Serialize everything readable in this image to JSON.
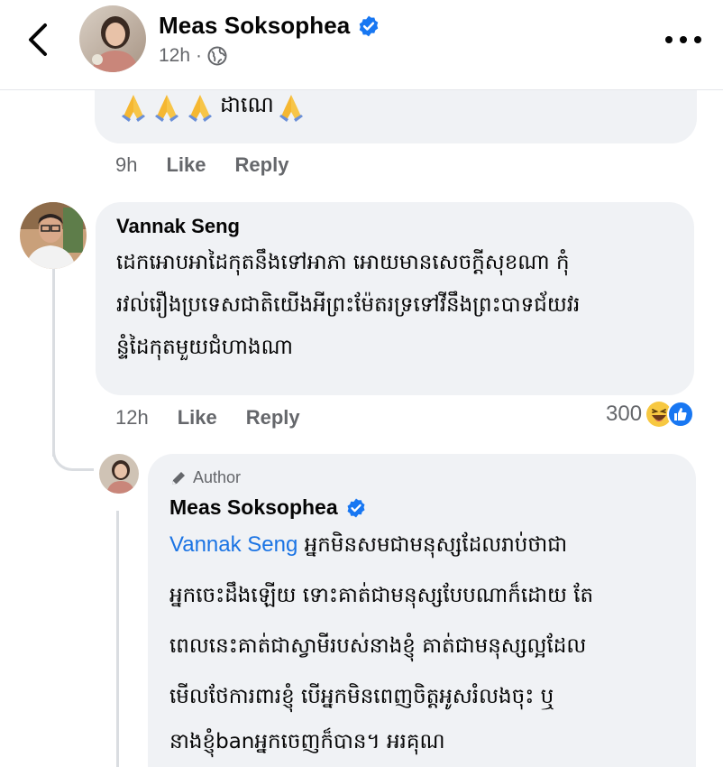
{
  "header": {
    "author_name": "Meas Soksophea",
    "time": "12h",
    "separator": "·",
    "icons": {
      "back": "chevron-left-icon",
      "verified": "verified-badge-icon",
      "audience": "globe-icon",
      "more": "more-options-icon"
    }
  },
  "prev_comment": {
    "text_suffix": "ដាណេ",
    "emoji": "praying-hands",
    "time": "9h",
    "like_label": "Like",
    "reply_label": "Reply"
  },
  "comment": {
    "author": "Vannak Seng",
    "lines": [
      "ដេកអោបអាដៃកុតនឹងទៅអាភា អោយមានសេចក្ដីសុខណា កុំ",
      "រវល់រឿងប្រទេសជាតិយើងអីព្រះម៉ែតរទ្រទៅវីនឹងព្រះបាទជ័យវរ",
      "ន្ទំដៃកុតមួយជំហាងណា"
    ],
    "time": "12h",
    "like_label": "Like",
    "reply_label": "Reply",
    "reaction_count": "300",
    "reaction_icons": [
      "haha-icon",
      "like-icon"
    ]
  },
  "reply": {
    "badge": "Author",
    "author": "Meas Soksophea",
    "mention": "Vannak Seng",
    "first_line_rest": " អ្នកមិនសមជាមនុស្សដែលរាប់ថាជា",
    "lines": [
      "អ្នកចេះដឹងឡើយ ទោះគាត់ជាមនុស្សបែបណាក៏ដោយ តែ",
      "ពេលនេះគាត់ជាស្វាមីរបស់នាងខ្ញុំ គាត់ជាមនុស្សល្អដែល",
      "មើលថែការពារខ្ញុំ បើអ្នកមិនពេញចិត្តអូសរំលងចុះ ឬ",
      "នាងខ្ញុំbanអ្នកចេញក៏បាន។ អរគុណ"
    ]
  },
  "colors": {
    "accent": "#1b74e4",
    "bubble": "#f0f2f5",
    "muted": "#65676b",
    "verified": "#1877f2"
  }
}
